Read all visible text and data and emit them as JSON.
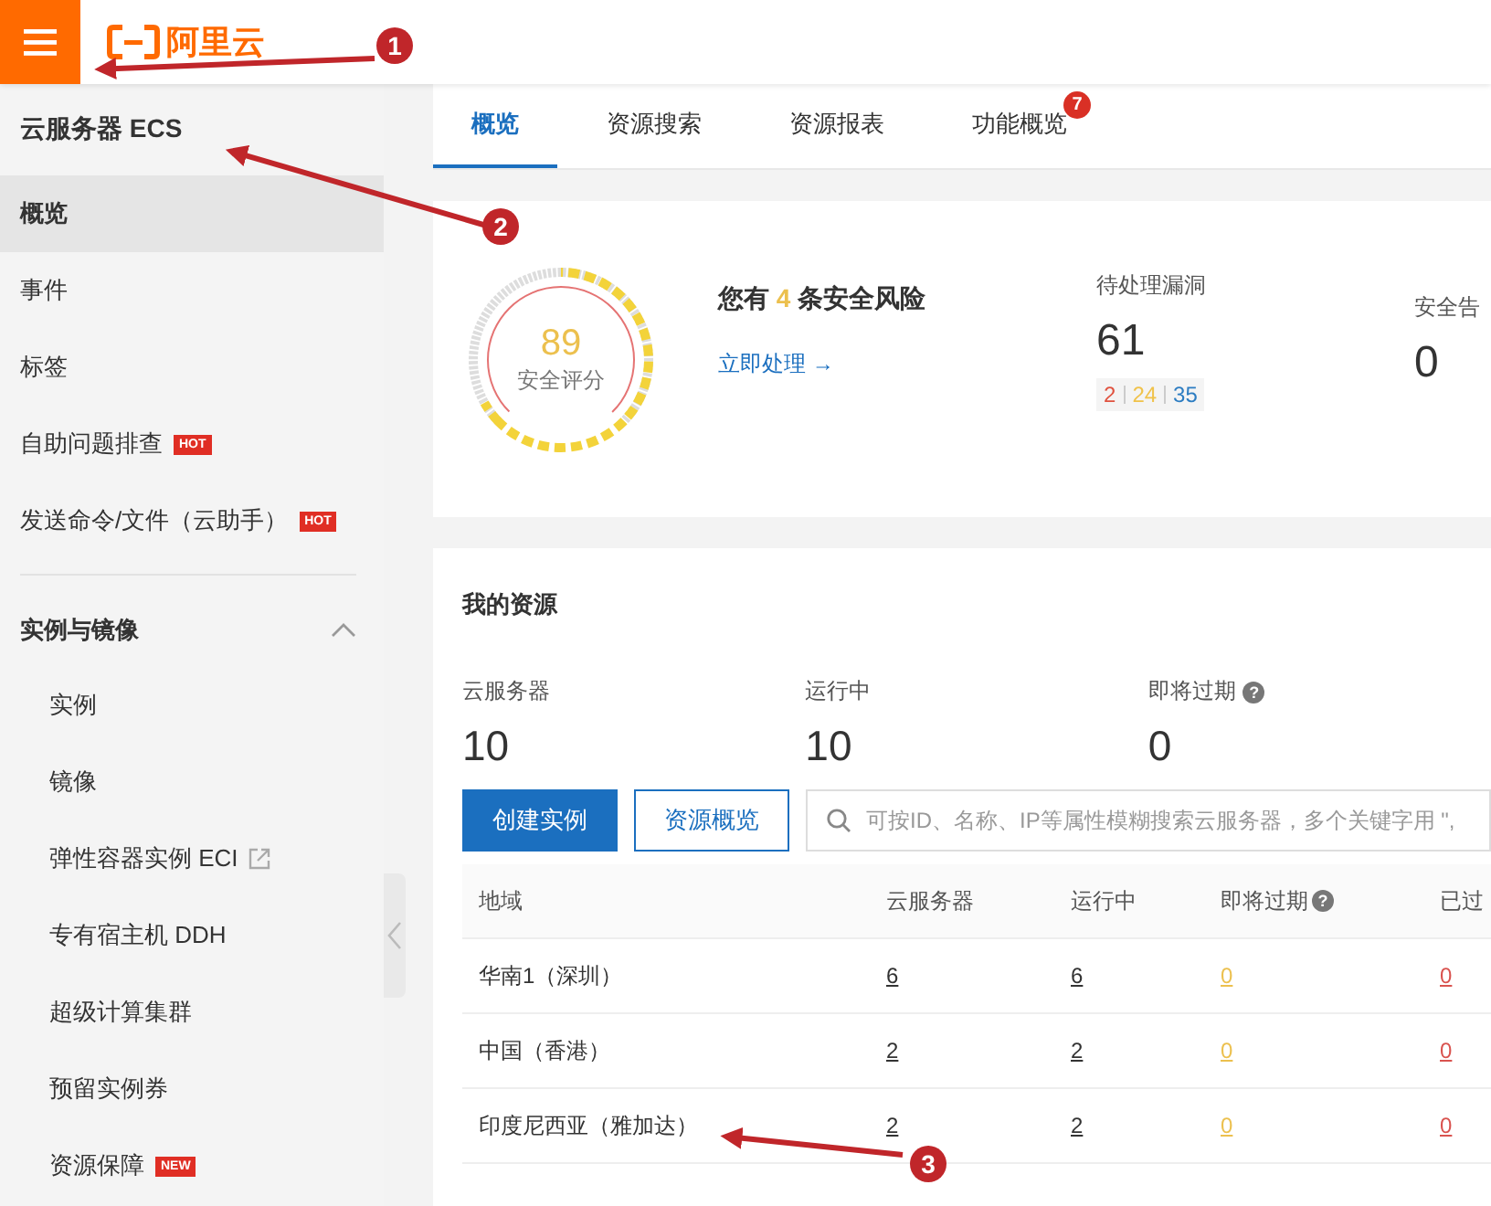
{
  "topbar": {
    "logo_text": "阿里云"
  },
  "sidebar": {
    "title": "云服务器 ECS",
    "items": [
      {
        "label": "概览",
        "selected": true
      },
      {
        "label": "事件",
        "selected": false
      },
      {
        "label": "标签",
        "selected": false
      },
      {
        "label": "自助问题排查",
        "selected": false,
        "badge": "HOT"
      },
      {
        "label": "发送命令/文件（云助手）",
        "selected": false,
        "badge": "HOT"
      }
    ],
    "groups": [
      {
        "label": "实例与镜像",
        "expanded": true,
        "items": [
          {
            "label": "实例",
            "selected": false
          },
          {
            "label": "镜像",
            "selected": false
          },
          {
            "label": "弹性容器实例 ECI",
            "selected": false,
            "external": true
          },
          {
            "label": "专有宿主机 DDH",
            "selected": false
          },
          {
            "label": "超级计算集群",
            "selected": false
          },
          {
            "label": "预留实例券",
            "selected": false
          },
          {
            "label": "资源保障",
            "selected": false,
            "badge": "NEW"
          }
        ]
      }
    ]
  },
  "tabs": [
    {
      "label": "概览",
      "selected": true
    },
    {
      "label": "资源搜索",
      "selected": false
    },
    {
      "label": "资源报表",
      "selected": false
    },
    {
      "label": "功能概览",
      "selected": false,
      "badge": "7"
    }
  ],
  "security": {
    "score": "89",
    "score_label": "安全评分",
    "risk_before": "您有",
    "risk_count": "4",
    "risk_after": "条安全风险",
    "action_link": "立即处理 →",
    "vulns": {
      "label": "待处理漏洞",
      "value": "61",
      "breakdown": [
        {
          "value": "2",
          "color": "#e0523f"
        },
        {
          "value": "24",
          "color": "#f0c24a"
        },
        {
          "value": "35",
          "color": "#2d7dc2"
        }
      ]
    },
    "alerts": {
      "label": "安全告",
      "value": "0"
    }
  },
  "resources": {
    "title": "我的资源",
    "stats": [
      {
        "label": "云服务器",
        "value": "10"
      },
      {
        "label": "运行中",
        "value": "10"
      },
      {
        "label": "即将过期",
        "value": "0",
        "help": "?"
      }
    ],
    "buttons": [
      {
        "label": "创建实例",
        "kind": "primary"
      },
      {
        "label": "资源概览",
        "kind": "secondary"
      }
    ],
    "search": {
      "placeholder": "可按ID、名称、IP等属性模糊搜索云服务器，多个关键字用 \","
    },
    "table": {
      "columns": [
        {
          "label": "地域"
        },
        {
          "label": "云服务器"
        },
        {
          "label": "运行中"
        },
        {
          "label": "即将过期",
          "help": "?"
        },
        {
          "label": "已过"
        }
      ],
      "rows": [
        [
          "华南1（深圳）",
          "6",
          "6",
          "0",
          "0"
        ],
        [
          "中国（香港）",
          "2",
          "2",
          "0",
          "0"
        ],
        [
          "印度尼西亚（雅加达）",
          "2",
          "2",
          "0",
          "0"
        ]
      ]
    }
  },
  "annotations": [
    {
      "label": "1"
    },
    {
      "label": "2"
    },
    {
      "label": "3"
    }
  ]
}
